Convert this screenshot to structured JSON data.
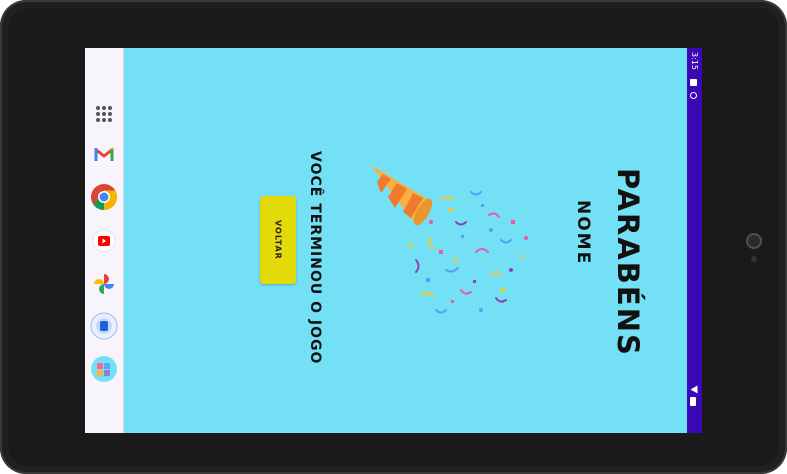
{
  "status_bar": {
    "time": "3:15"
  },
  "taskbar": {
    "apps": [
      {
        "name": "all-apps-icon"
      },
      {
        "name": "gmail-icon"
      },
      {
        "name": "chrome-icon"
      },
      {
        "name": "youtube-icon"
      },
      {
        "name": "photos-icon"
      },
      {
        "name": "app-icon"
      },
      {
        "name": "puzzle-app-icon"
      }
    ]
  },
  "game": {
    "title": "PARABÉNS",
    "player_name": "NOME",
    "message": "VOCÊ TERMINOU O JOGO",
    "back_button": "VOLTAR"
  },
  "colors": {
    "background": "#74E0F6",
    "button": "#E4DA0A",
    "status_bar": "#3A09B5"
  }
}
